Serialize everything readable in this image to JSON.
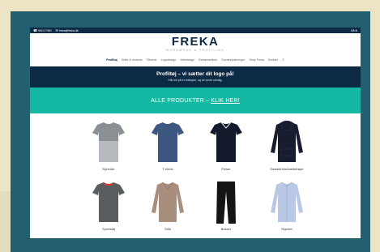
{
  "topbar": {
    "phone": "9613 7050",
    "email": "freka@freka.dk",
    "right_link": "Gå til"
  },
  "brand": {
    "name": "FREKA",
    "tagline": "WORKWEAR & PROFILING"
  },
  "nav": {
    "items": [
      "Profiltøj",
      "Skilte & reklame",
      "Tilbehør",
      "Logodesign",
      "Webdesign",
      "Reklamartikler",
      "Gaveindpakninger",
      "Shop Freka",
      "Kontakt"
    ]
  },
  "banner": {
    "title": "Profiltøj – vi sætter dit logo på!",
    "subtitle": "Klik ind på en kategori, og se vores udvalg."
  },
  "cta": {
    "text": "ALLE PRODUKTER –",
    "link": "KLIK HER!"
  },
  "products": [
    {
      "label": "Nyheder",
      "icon": "tshirt-grey-melange-icon",
      "color": "#8a8f93",
      "accent": "#b7bbbf"
    },
    {
      "label": "T-shirts",
      "icon": "tshirt-blue-icon",
      "color": "#3e5780",
      "accent": "#3e5780"
    },
    {
      "label": "Polser",
      "icon": "polo-navy-icon",
      "color": "#131a2b",
      "accent": "#131a2b"
    },
    {
      "label": "Sweatshirts/hættetrøjer",
      "icon": "hoodie-navy-icon",
      "color": "#171c2e",
      "accent": "#171c2e"
    },
    {
      "label": "Sportstøj",
      "icon": "sport-shirt-icon",
      "color": "#5a5d60",
      "accent": "#d03a3a"
    },
    {
      "label": "Strik",
      "icon": "knit-sweater-icon",
      "color": "#a88e7c",
      "accent": "#a88e7c"
    },
    {
      "label": "Bukser",
      "icon": "trousers-icon",
      "color": "#141414",
      "accent": "#141414"
    },
    {
      "label": "Skjorter",
      "icon": "shirt-lightblue-icon",
      "color": "#b9c8e4",
      "accent": "#b9c8e4"
    }
  ]
}
